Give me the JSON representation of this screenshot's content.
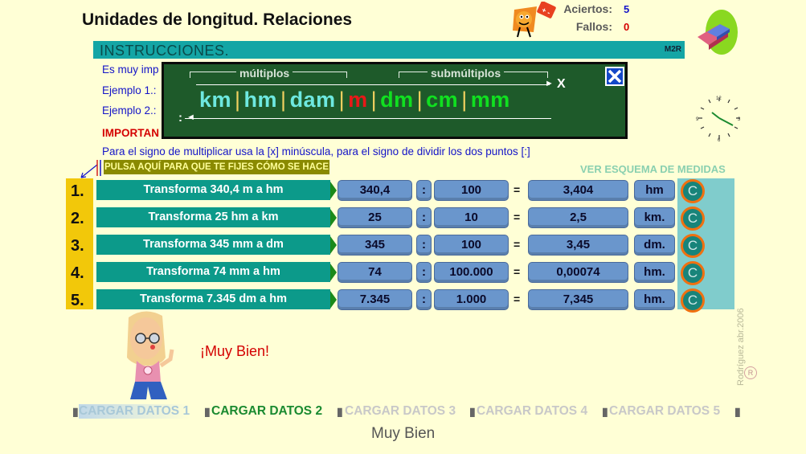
{
  "header": {
    "title": "Unidades de longitud. Relaciones",
    "aciertos_label": "Aciertos:",
    "aciertos_value": "5",
    "fallos_label": "Fallos:",
    "fallos_value": "0"
  },
  "instructions": {
    "title": "INSTRUCCIONES.",
    "badge": "M2R",
    "line1": "Es muy imp",
    "line2": "Ejemplo 1.:",
    "line3": "Ejemplo 2.:",
    "line4": "IMPORTAN",
    "line5": "Para el signo de multiplicar usa la [x] minúscula, para el signo de dividir los dos puntos [:]"
  },
  "scheme": {
    "multiples_label": "múltiplos",
    "submultiples_label": "submúltiplos",
    "units": [
      "km",
      "hm",
      "dam",
      "m",
      "dm",
      "cm",
      "mm"
    ],
    "separator": "|",
    "multiply_sign": "X",
    "divide_sign": ":",
    "close_icon": "close-x-icon"
  },
  "tip_button": "PULSA AQUÍ PARA QUE TE FIJES CÓMO SE HACE",
  "scheme_link": "VER ESQUEMA DE MEDIDAS",
  "exercises": [
    {
      "num": "1.",
      "prompt": "Transforma 340,4 m a hm",
      "value": "340,4",
      "op": ":",
      "factor": "100",
      "eq": "=",
      "result": "3,404",
      "unit": "hm",
      "check": "C"
    },
    {
      "num": "2.",
      "prompt": "Transforma 25 hm a km",
      "value": "25",
      "op": ":",
      "factor": "10",
      "eq": "=",
      "result": "2,5",
      "unit": "km.",
      "check": "C"
    },
    {
      "num": "3.",
      "prompt": "Transforma 345 mm a dm",
      "value": "345",
      "op": ":",
      "factor": "100",
      "eq": "=",
      "result": "3,45",
      "unit": "dm.",
      "check": "C"
    },
    {
      "num": "4.",
      "prompt": "Transforma 74 mm a hm",
      "value": "74",
      "op": ":",
      "factor": "100.000",
      "eq": "=",
      "result": "0,00074",
      "unit": "hm.",
      "check": "C"
    },
    {
      "num": "5.",
      "prompt": "Transforma 7.345 dm a hm",
      "value": "7.345",
      "op": ":",
      "factor": "1.000",
      "eq": "=",
      "result": "7,345",
      "unit": "hm.",
      "check": "C"
    }
  ],
  "feedback": "¡Muy Bien!",
  "copyright": "Rodríguez abr.2006",
  "copy_symbol": "R",
  "loads": [
    "CARGAR DATOS 1",
    "CARGAR DATOS 2",
    "CARGAR DATOS 3",
    "CARGAR DATOS 4",
    "CARGAR DATOS 5"
  ],
  "status": "Muy Bien",
  "colors": {
    "background": "#ffffd6",
    "teal": "#0c9a8a",
    "board": "#1e5a2a",
    "cell": "#6a96cc",
    "feedback": "#d40000",
    "active_load": "#1a8a30"
  }
}
